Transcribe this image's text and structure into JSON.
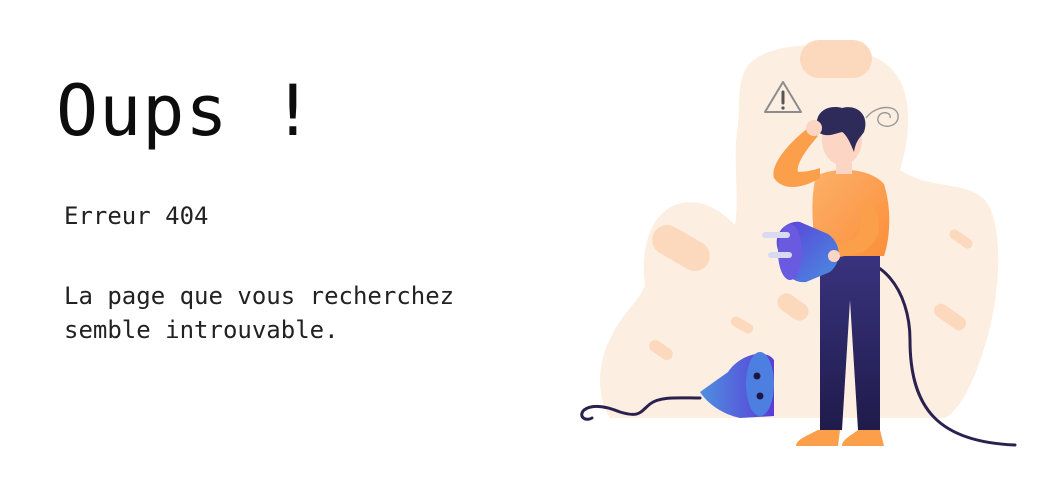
{
  "heading": "Oups !",
  "error_code": "Erreur 404",
  "message": {
    "line1": "La page que vous recherchez",
    "line2": "semble introuvable."
  },
  "illustration": {
    "icon": "warning-triangle-icon",
    "subject": "person-holding-unplugged-cable",
    "colors": {
      "blob": "#fdeee2",
      "blob_accent": "#fcd9bd",
      "shirt": "#fb9f4a",
      "pants": "#2b2760",
      "plug_start": "#5b3fd8",
      "plug_end": "#4a8ee0",
      "cable": "#2a2150",
      "skin": "#fcd5c4",
      "hair": "#2e2a5a"
    }
  }
}
